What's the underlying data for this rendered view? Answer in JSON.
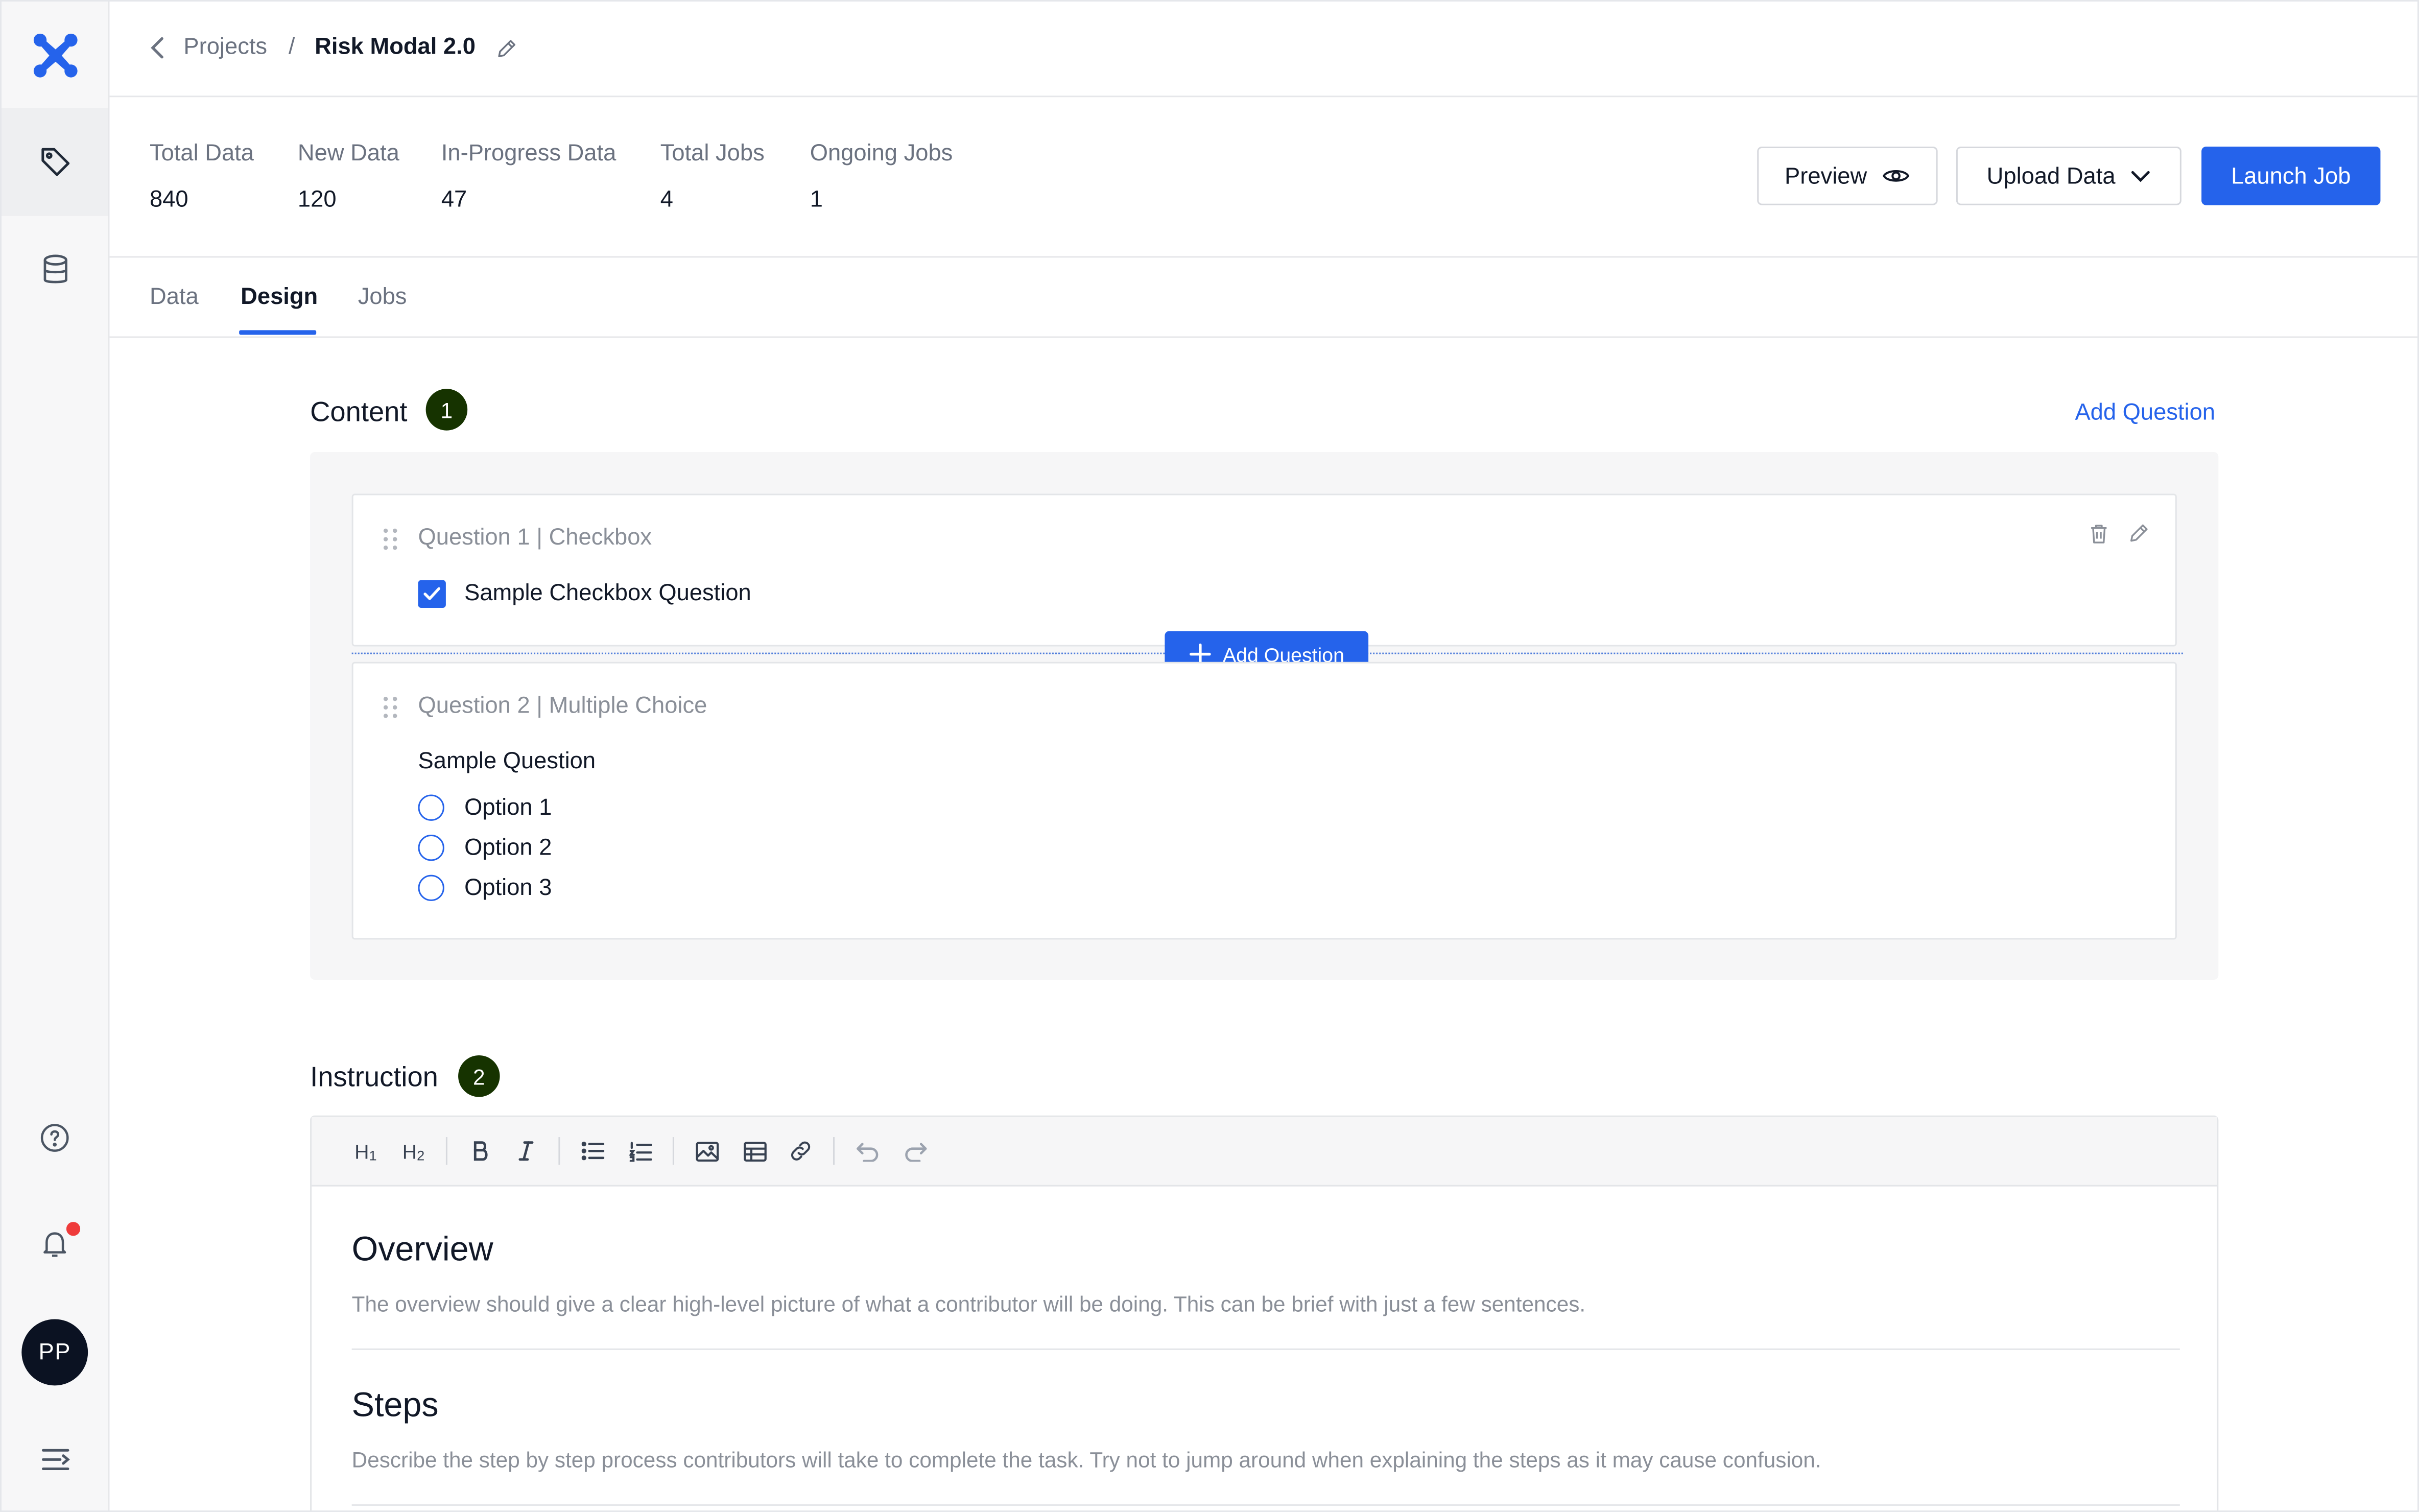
{
  "colors": {
    "accent": "#2563eb",
    "badge": "#163300",
    "notification": "#ef3b3b"
  },
  "sidebar": {
    "logo_icon": "x-logo",
    "items": [
      {
        "icon": "tag-icon",
        "active": true
      },
      {
        "icon": "database-icon",
        "active": false
      }
    ],
    "bottom": [
      {
        "icon": "help-circle-icon"
      },
      {
        "icon": "bell-icon",
        "has_notification": true
      },
      {
        "icon": "expand-menu-icon"
      }
    ],
    "avatar_initials": "PP"
  },
  "header": {
    "breadcrumb": {
      "parent": "Projects",
      "separator": "/",
      "current": "Risk Modal 2.0"
    }
  },
  "stats": [
    {
      "label": "Total Data",
      "value": "840"
    },
    {
      "label": "New Data",
      "value": "120"
    },
    {
      "label": "In-Progress Data",
      "value": "47"
    },
    {
      "label": "Total Jobs",
      "value": "4"
    },
    {
      "label": "Ongoing Jobs",
      "value": "1"
    }
  ],
  "actions": {
    "preview": "Preview",
    "upload": "Upload Data",
    "launch": "Launch Job"
  },
  "tabs": [
    {
      "label": "Data",
      "active": false
    },
    {
      "label": "Design",
      "active": true
    },
    {
      "label": "Jobs",
      "active": false
    }
  ],
  "content": {
    "title": "Content",
    "step": "1",
    "add_question_link": "Add Question",
    "add_question_button": "Add Question",
    "questions": [
      {
        "header": "Question 1 | Checkbox",
        "checkbox_label": "Sample Checkbox Question",
        "checked": true
      },
      {
        "header": "Question 2 | Multiple Choice",
        "prompt": "Sample Question",
        "options": [
          "Option 1",
          "Option 2",
          "Option 3"
        ]
      }
    ]
  },
  "instruction": {
    "title": "Instruction",
    "step": "2",
    "toolbar": [
      "H1",
      "H2",
      "bold",
      "italic",
      "bullet-list",
      "numbered-list",
      "image",
      "table",
      "link",
      "undo",
      "redo"
    ],
    "sections": [
      {
        "heading": "Overview",
        "body": "The overview should give a clear high-level picture of what a contributor will be doing. This can be brief with just a few sentences."
      },
      {
        "heading": "Steps",
        "body": "Describe the step by step process contributors will take to complete the task. Try not to jump around when explaining the steps as it may cause confusion."
      }
    ]
  }
}
